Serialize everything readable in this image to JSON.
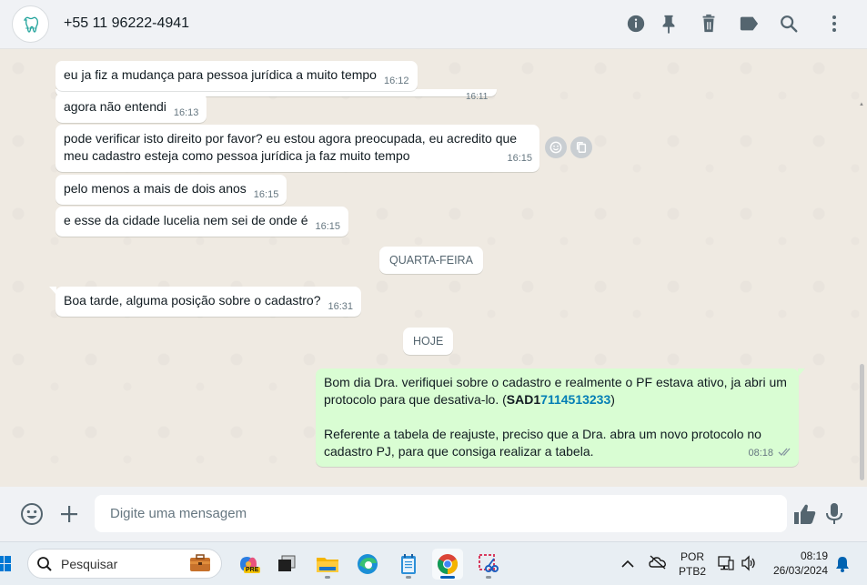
{
  "header": {
    "contact_name": "+55 11 96222-4941",
    "icons": [
      "info-icon",
      "pin-icon",
      "delete-icon",
      "label-icon",
      "search-icon",
      "menu-icon"
    ]
  },
  "chat": {
    "cut_time": "16:11",
    "messages": [
      {
        "text": "eu ja fiz a mudança para pessoa jurídica a muito tempo",
        "time": "16:12"
      },
      {
        "text": "agora não entendi",
        "time": "16:13"
      },
      {
        "text_line1": "pode verificar isto direito por favor? eu estou agora preocupada, eu acredito que",
        "text_line2": "meu cadastro esteja como pessoa jurídica ja faz muito tempo",
        "time": "16:15"
      },
      {
        "text": "pelo menos a mais de dois anos",
        "time": "16:15"
      },
      {
        "text": "e esse da cidade lucelia nem sei de onde é",
        "time": "16:15"
      },
      {
        "text": "Boa tarde, alguma posição sobre o cadastro?",
        "time": "16:31"
      }
    ],
    "date_chips": [
      "QUARTA-FEIRA",
      "HOJE"
    ],
    "outgoing": {
      "line1": "Bom dia Dra. verifiquei sobre o cadastro e realmente o PF estava ativo, ja abri um",
      "line2_pre": "protocolo para que desativa-lo. (",
      "line2_bold": "SAD1",
      "line2_link": "7114513233",
      "line2_post": ")",
      "line3": "Referente a tabela de reajuste, preciso que a Dra. abra um novo protocolo no",
      "line4": "cadastro PJ, para que consiga realizar a tabela.",
      "time": "08:18",
      "status": "read"
    }
  },
  "compose": {
    "placeholder": "Digite uma mensagem"
  },
  "taskbar": {
    "search_label": "Pesquisar",
    "lang_line1": "POR",
    "lang_line2": "PTB2",
    "clock_time": "08:19",
    "clock_date": "26/03/2024"
  },
  "colors": {
    "chat_bg": "#efeae2",
    "outgoing_bubble": "#d9fdd3",
    "link": "#027eb5",
    "header_bg": "#f0f2f5"
  }
}
